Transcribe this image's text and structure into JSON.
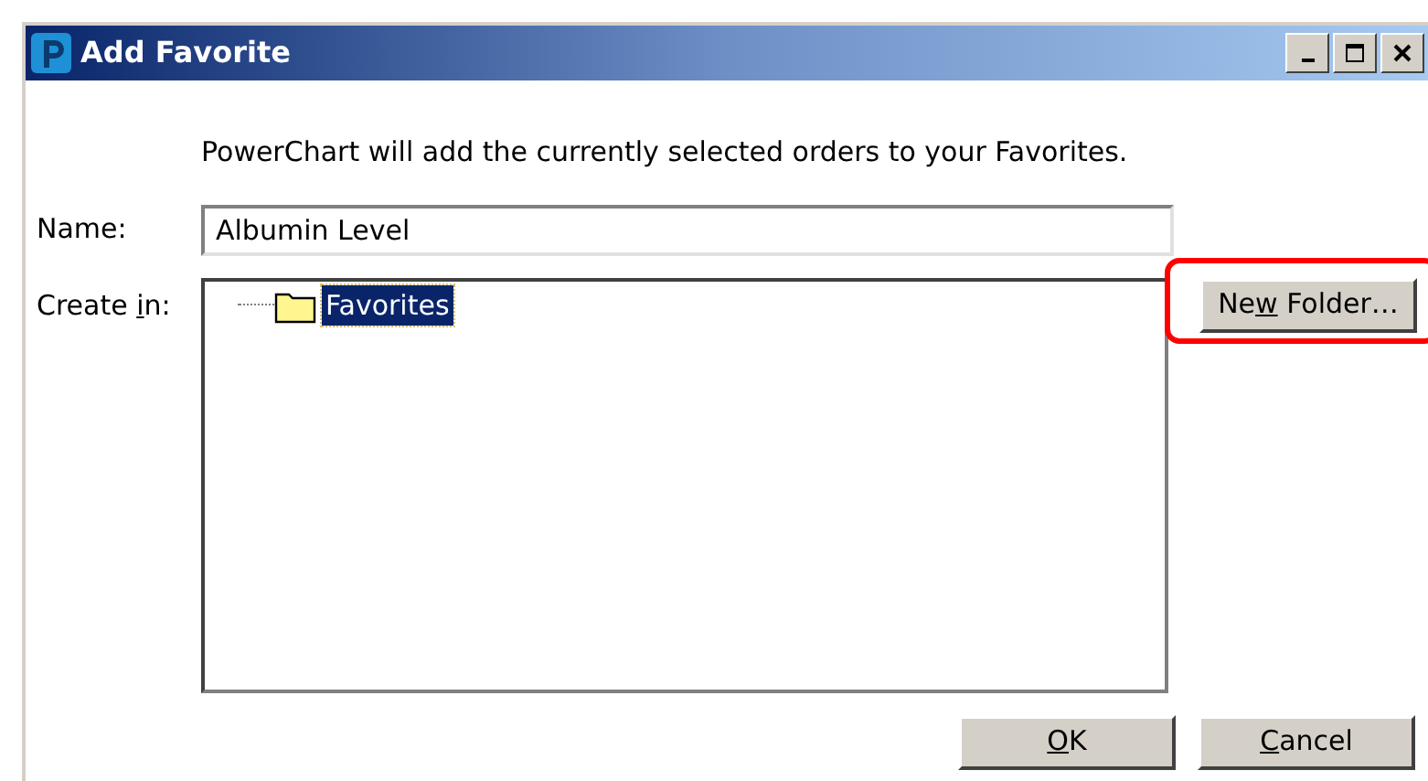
{
  "window": {
    "title": "Add Favorite",
    "controls": [
      {
        "kind": "minimize"
      },
      {
        "kind": "maximize"
      },
      {
        "kind": "close"
      }
    ]
  },
  "message": "PowerChart will add the currently selected orders to your Favorites.",
  "name_field": {
    "label": "Name:",
    "value": "Albumin Level"
  },
  "create_in": {
    "label": {
      "before": "Create ",
      "key": "i",
      "after": "n:"
    },
    "tree": [
      {
        "label": "Favorites",
        "selected": true
      }
    ]
  },
  "new_folder_button": {
    "label": {
      "before": "Ne",
      "key": "w",
      "after": " Folder…"
    },
    "highlighted": true
  },
  "buttons": [
    {
      "label": {
        "key": "O",
        "after": "K"
      }
    },
    {
      "label": {
        "key": "C",
        "after": "ancel"
      }
    }
  ]
}
